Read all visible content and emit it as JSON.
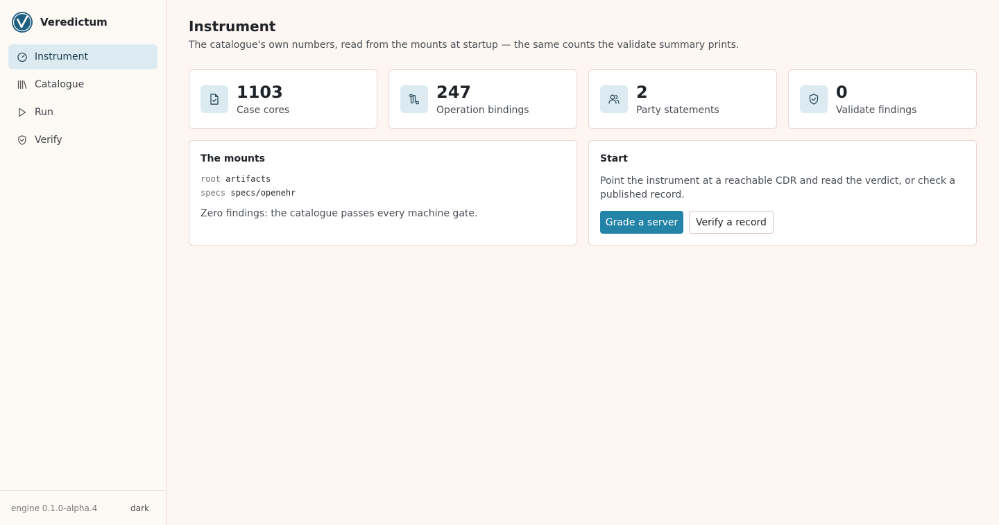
{
  "app": {
    "name": "Veredictum",
    "version": "engine 0.1.0-alpha.4",
    "theme_toggle": "dark",
    "colors": {
      "accent": "#2384a8",
      "nav_active_bg": "#dcebf2",
      "page_bg": "#fdf6f2"
    }
  },
  "sidebar": {
    "items": [
      {
        "label": "Instrument",
        "icon": "gauge-icon",
        "active": true
      },
      {
        "label": "Catalogue",
        "icon": "library-icon",
        "active": false
      },
      {
        "label": "Run",
        "icon": "play-icon",
        "active": false
      },
      {
        "label": "Verify",
        "icon": "shield-check-icon",
        "active": false
      }
    ]
  },
  "page": {
    "title": "Instrument",
    "subtitle": "The catalogue's own numbers, read from the mounts at startup — the same counts the validate summary prints."
  },
  "stats": [
    {
      "value": "1103",
      "label": "Case cores",
      "icon": "file-check-icon"
    },
    {
      "value": "247",
      "label": "Operation bindings",
      "icon": "route-icon"
    },
    {
      "value": "2",
      "label": "Party statements",
      "icon": "users-icon"
    },
    {
      "value": "0",
      "label": "Validate findings",
      "icon": "shield-check-icon"
    }
  ],
  "mounts": {
    "title": "The mounts",
    "rows": [
      {
        "key": "root",
        "value": "artifacts"
      },
      {
        "key": "specs",
        "value": "specs/openehr"
      }
    ],
    "note": "Zero findings: the catalogue passes every machine gate."
  },
  "start": {
    "title": "Start",
    "text": "Point the instrument at a reachable CDR and read the verdict, or check a published record.",
    "primary_button": "Grade a server",
    "secondary_button": "Verify a record"
  }
}
